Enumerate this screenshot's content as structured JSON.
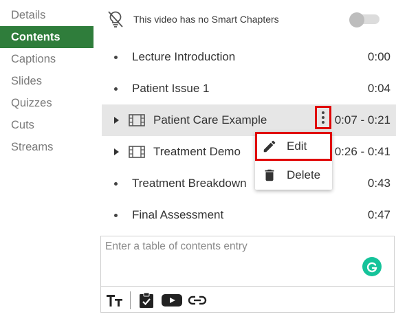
{
  "sidebar": {
    "items": [
      {
        "label": "Details"
      },
      {
        "label": "Contents"
      },
      {
        "label": "Captions"
      },
      {
        "label": "Slides"
      },
      {
        "label": "Quizzes"
      },
      {
        "label": "Cuts"
      },
      {
        "label": "Streams"
      }
    ],
    "active_index": 1
  },
  "header": {
    "hint": "This video has no Smart Chapters",
    "smart_chapters_toggle": "off"
  },
  "entries": [
    {
      "title": "Lecture Introduction",
      "time": "0:00",
      "kind": "point"
    },
    {
      "title": "Patient Issue 1",
      "time": "0:04",
      "kind": "point"
    },
    {
      "title": "Patient Care Example",
      "time": "0:07 - 0:21",
      "kind": "clip"
    },
    {
      "title": "Treatment Demo",
      "time": "0:26 - 0:41",
      "kind": "clip"
    },
    {
      "title": "Treatment Breakdown",
      "time": "0:43",
      "kind": "point"
    },
    {
      "title": "Final Assessment",
      "time": "0:47",
      "kind": "point"
    }
  ],
  "context_menu": {
    "items": [
      {
        "label": "Edit",
        "icon": "pencil-icon"
      },
      {
        "label": "Delete",
        "icon": "trash-icon"
      }
    ]
  },
  "editor": {
    "placeholder": "Enter a table of contents entry",
    "value": ""
  },
  "colors": {
    "active_bg": "#2f7d3b",
    "highlight": "#e00000",
    "grammarly": "#15c39a"
  }
}
